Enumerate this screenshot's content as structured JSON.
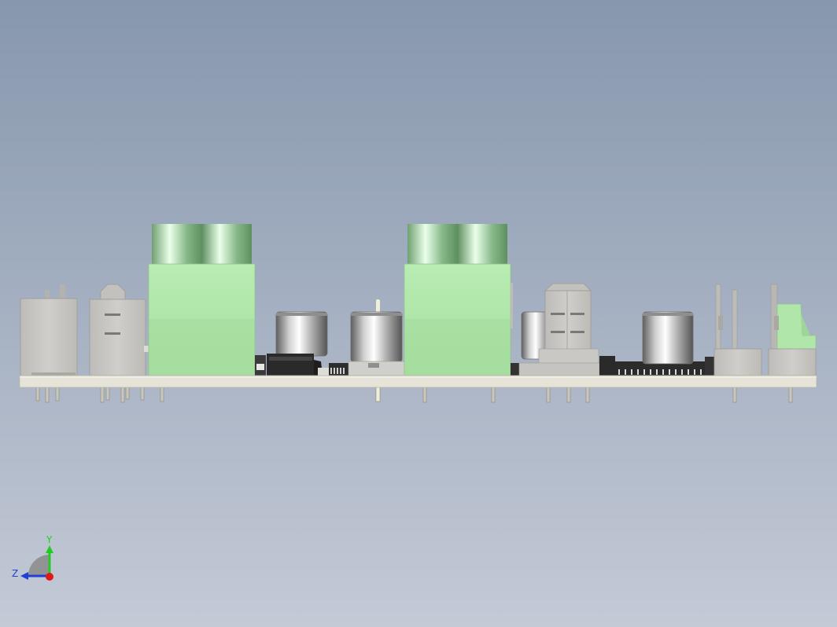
{
  "view": {
    "background_top": "#8797ad",
    "background_bottom": "#c4cad6"
  },
  "triad": {
    "y_label": "Y",
    "z_label": "Z",
    "y_color": "#22cc22",
    "z_color": "#1f3fd6",
    "x_color": "#e01818"
  },
  "colors": {
    "board": "#e6e4d9",
    "connector_grey": "#c9c8c4",
    "terminal_green": "#b3e8ad",
    "cap_silver": "#d4d4d4",
    "ic_black": "#2a2a2a",
    "pin": "#c9c7bd"
  }
}
